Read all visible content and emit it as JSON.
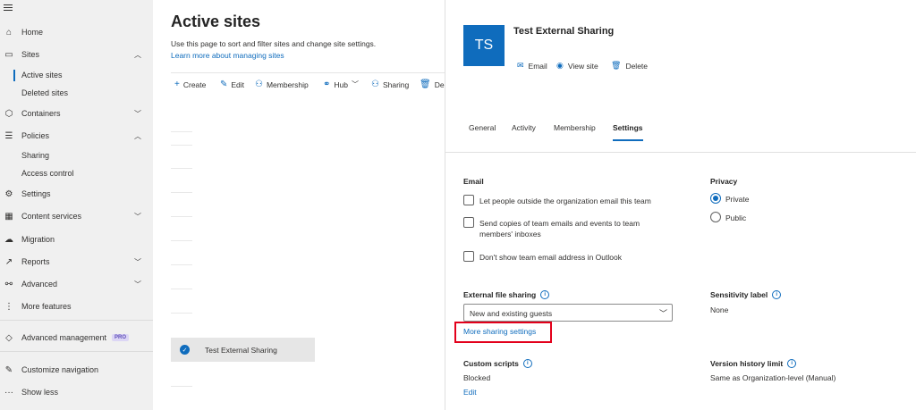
{
  "nav": {
    "items": [
      {
        "label": "Home",
        "icon": "home-icon"
      },
      {
        "label": "Sites",
        "icon": "sites-icon",
        "chevron": "up"
      },
      {
        "label": "Active sites"
      },
      {
        "label": "Deleted sites"
      },
      {
        "label": "Containers",
        "icon": "containers-icon",
        "chevron": "down"
      },
      {
        "label": "Policies",
        "icon": "policies-icon",
        "chevron": "up"
      },
      {
        "label": "Sharing"
      },
      {
        "label": "Access control"
      },
      {
        "label": "Settings",
        "icon": "gear-icon"
      },
      {
        "label": "Content services",
        "icon": "content-services-icon",
        "chevron": "down"
      },
      {
        "label": "Migration",
        "icon": "cloud-icon"
      },
      {
        "label": "Reports",
        "icon": "chart-icon",
        "chevron": "down"
      },
      {
        "label": "Advanced",
        "icon": "advanced-icon",
        "chevron": "down"
      },
      {
        "label": "More features",
        "icon": "more-icon"
      },
      {
        "label": "Advanced management",
        "icon": "diamond-icon",
        "badge": "PRO"
      },
      {
        "label": "Customize navigation",
        "icon": "pencil-icon"
      },
      {
        "label": "Show less",
        "icon": "ellipsis-icon"
      }
    ]
  },
  "main": {
    "title": "Active sites",
    "description": "Use this page to sort and filter sites and change site settings.",
    "learn_more": "Learn more about managing sites",
    "toolbar": {
      "create": "Create",
      "edit": "Edit",
      "membership": "Membership",
      "hub": "Hub",
      "sharing": "Sharing",
      "delete": "Del"
    },
    "selected_row": "Test External Sharing"
  },
  "panel": {
    "avatar": "TS",
    "title": "Test External Sharing",
    "actions": {
      "email": "Email",
      "view_site": "View site",
      "delete": "Delete"
    },
    "tabs": [
      "General",
      "Activity",
      "Membership",
      "Settings"
    ],
    "active_tab": "Settings",
    "email": {
      "label": "Email",
      "option1": "Let people outside the organization email this team",
      "option2": "Send copies of team emails and events to team members' inboxes",
      "option3": "Don't show team email address in Outlook"
    },
    "privacy": {
      "label": "Privacy",
      "private": "Private",
      "public": "Public",
      "selected": "Private"
    },
    "external_sharing": {
      "label": "External file sharing",
      "value": "New and existing guests",
      "more_link": "More sharing settings"
    },
    "sensitivity": {
      "label": "Sensitivity label",
      "value": "None"
    },
    "custom_scripts": {
      "label": "Custom scripts",
      "value": "Blocked",
      "edit": "Edit"
    },
    "version_history": {
      "label": "Version history limit",
      "value": "Same as Organization-level (Manual)"
    }
  },
  "colors": {
    "accent": "#0f6cbd",
    "highlight": "#e3001b"
  }
}
